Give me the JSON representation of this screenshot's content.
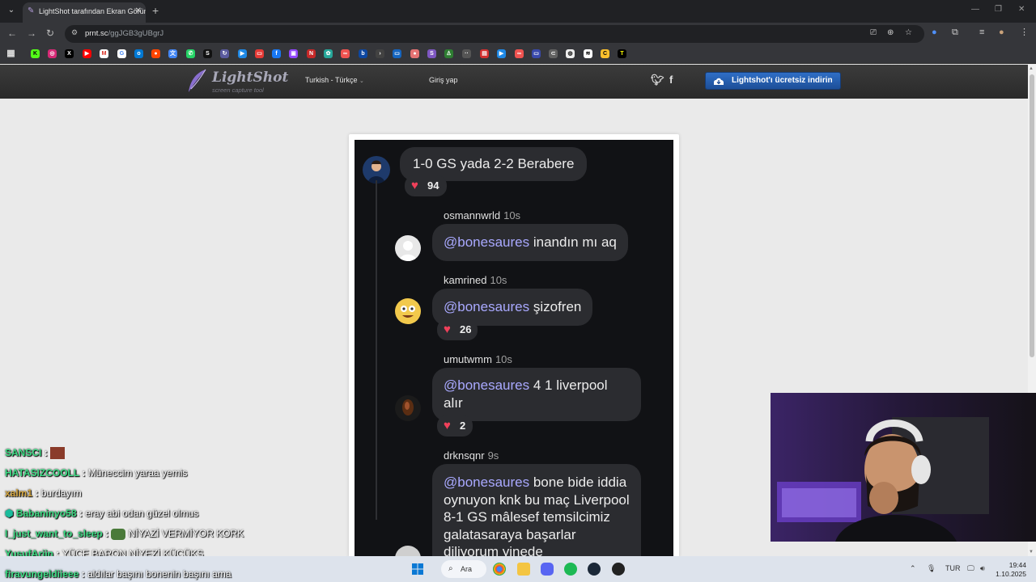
{
  "browser": {
    "tab_title": "LightShot tarafından Ekran Görüntüsü",
    "url_host": "prnt.sc",
    "url_path": "/ggJGB3gUBgrJ"
  },
  "lightshot": {
    "logo": "LightShot",
    "tagline": "screen capture tool",
    "language": "Turkish - Türkçe",
    "login": "Giriş yap",
    "download": "Lightshot'ı ücretsiz indirin"
  },
  "screenshot": {
    "top_comment": {
      "text": "1-0 GS yada 2-2 Berabere",
      "likes": "94"
    },
    "replies": [
      {
        "user": "osmannwrld",
        "time": "10s",
        "mention": "@bonesaures",
        "text": "inandın mı aq",
        "likes": ""
      },
      {
        "user": "kamrined",
        "time": "10s",
        "mention": "@bonesaures",
        "text": "şizofren",
        "likes": "26"
      },
      {
        "user": "umutwmm",
        "time": "10s",
        "mention": "@bonesaures",
        "text": "4 1 liverpool alır",
        "likes": "2"
      },
      {
        "user": "drknsqnr",
        "time": "9s",
        "mention": "@bonesaures",
        "text": "bone bide iddia oynuyon knk bu maç Liverpool 8-1 GS mâlesef temsilcimiz galatasaraya başarlar diliyorum yinede",
        "likes": ""
      }
    ]
  },
  "chat": [
    {
      "user": "SANSCI",
      "sep": ":",
      "msg": "",
      "color": "#3ddc84"
    },
    {
      "user": "HATASIZCOOLL",
      "sep": ":",
      "msg": "Müneccim yaraa yemis",
      "color": "#3ddc84"
    },
    {
      "user": "xalm1",
      "sep": ":",
      "msg": "burdayım",
      "color": "#d4a640"
    },
    {
      "user": "Babaninyo58",
      "sep": ":",
      "msg": "eray abi odan güzel olmus",
      "color": "#3ddc84"
    },
    {
      "user": "I_just_want_to_sleep",
      "sep": ":",
      "msg": "NİYAZİ VERMİYOR KORK",
      "color": "#3ddc84"
    },
    {
      "user": "YusufArjin",
      "sep": ":",
      "msg": "YÜCE BARON NİYEZİ KÜÇÜKS",
      "color": "#3ddc84"
    },
    {
      "user": "firavungeldiieee",
      "sep": ":",
      "msg": "aldılar başını bonenin başını ama",
      "color": "#3ddc84"
    }
  ],
  "taskbar": {
    "search": "Ara",
    "lang": "TUR",
    "time": "19:44",
    "date": "1.10.2025"
  },
  "colors": {
    "accent_blue": "#2f6fc6",
    "chat_green": "#3ddc84",
    "mention": "#a9a9ff",
    "heart": "#f0405a"
  }
}
